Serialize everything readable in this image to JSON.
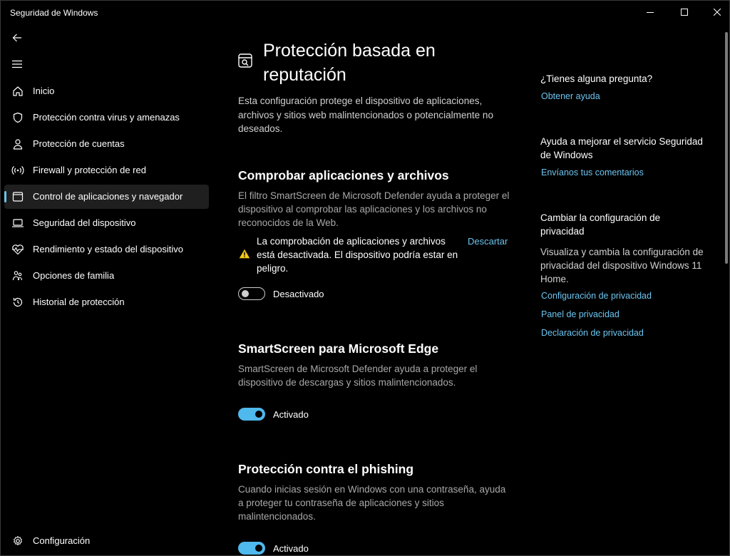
{
  "window": {
    "title": "Seguridad de Windows"
  },
  "sidebar": {
    "items": [
      {
        "label": "Inicio",
        "icon": "home-icon"
      },
      {
        "label": "Protección contra virus y amenazas",
        "icon": "shield-icon"
      },
      {
        "label": "Protección de cuentas",
        "icon": "person-icon"
      },
      {
        "label": "Firewall y protección de red",
        "icon": "wifi-antenna-icon"
      },
      {
        "label": "Control de aplicaciones y navegador",
        "icon": "app-browser-icon",
        "selected": true
      },
      {
        "label": "Seguridad del dispositivo",
        "icon": "laptop-icon"
      },
      {
        "label": "Rendimiento y estado del dispositivo",
        "icon": "heart-pulse-icon"
      },
      {
        "label": "Opciones de familia",
        "icon": "family-icon"
      },
      {
        "label": "Historial de protección",
        "icon": "history-icon"
      }
    ],
    "settings_label": "Configuración"
  },
  "main": {
    "title": "Protección basada en reputación",
    "intro": "Esta configuración protege el dispositivo de aplicaciones, archivos y sitios web malintencionados o potencialmente no deseados.",
    "sections": [
      {
        "title": "Comprobar aplicaciones y archivos",
        "description": "El filtro SmartScreen de Microsoft Defender ayuda a proteger el dispositivo al comprobar las aplicaciones y los archivos no reconocidos de la Web.",
        "warning": "La comprobación de aplicaciones y archivos está desactivada. El dispositivo podría estar en peligro.",
        "dismiss": "Descartar",
        "toggle_state": "off",
        "toggle_label": "Desactivado"
      },
      {
        "title": "SmartScreen para Microsoft Edge",
        "description": "SmartScreen de Microsoft Defender ayuda a proteger el dispositivo de descargas y sitios malintencionados.",
        "toggle_state": "on",
        "toggle_label": "Activado"
      },
      {
        "title": "Protección contra el phishing",
        "description": "Cuando inicias sesión en Windows con una contraseña, ayuda a proteger tu contraseña de aplicaciones y sitios malintencionados.",
        "toggle_state": "on",
        "toggle_label": "Activado"
      }
    ]
  },
  "right_panel": {
    "question_heading": "¿Tienes alguna pregunta?",
    "help_link": "Obtener ayuda",
    "improve_heading": "Ayuda a mejorar el servicio Seguridad de Windows",
    "feedback_link": "Envíanos tus comentarios",
    "privacy_heading": "Cambiar la configuración de privacidad",
    "privacy_text": "Visualiza y cambia la configuración de privacidad del dispositivo Windows 11 Home.",
    "privacy_links": [
      "Configuración de privacidad",
      "Panel de privacidad",
      "Declaración de privacidad"
    ]
  },
  "colors": {
    "accent": "#6cc4ef",
    "toggle_on": "#4fb8ec",
    "warning": "#f2c811",
    "selected_bg": "#1f1f1f"
  }
}
